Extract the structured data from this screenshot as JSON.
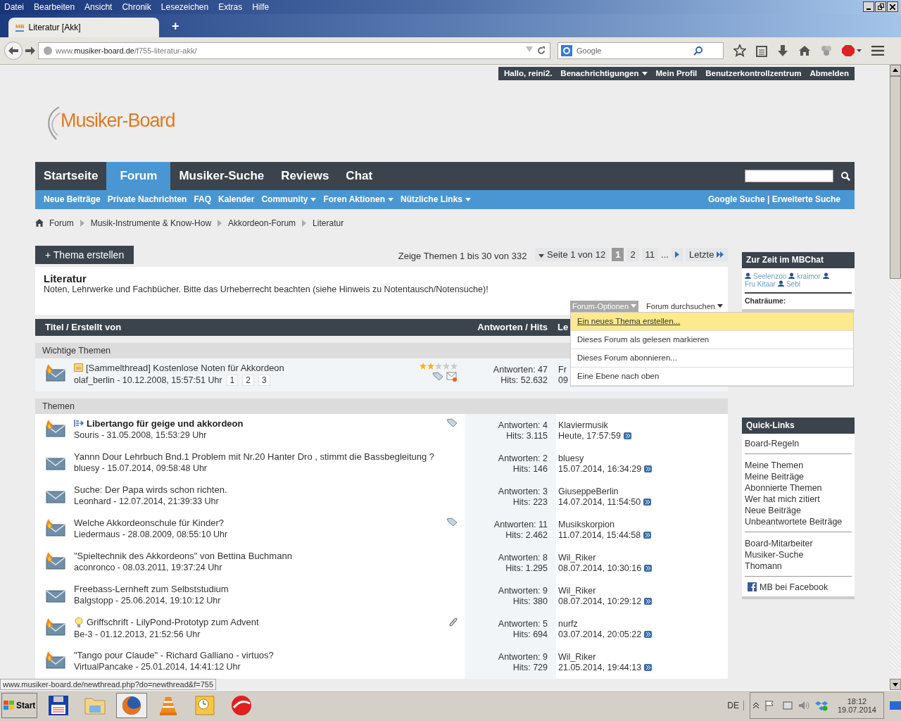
{
  "browser": {
    "menu": [
      "Datei",
      "Bearbeiten",
      "Ansicht",
      "Chronik",
      "Lesezeichen",
      "Extras",
      "Hilfe"
    ],
    "tab": {
      "favicon": "MB",
      "title": "Literatur [Akk]"
    },
    "new_tab": "+",
    "url": {
      "host_prefix": "www.",
      "host": "musiker-board.de",
      "path": "/f755-literatur-akk/"
    },
    "search": {
      "placeholder": "Google"
    },
    "status_link": "www.musiker-board.de/newthread.php?do=newthread&f=755"
  },
  "user_bar": [
    "Hallo, reini2.",
    "Benachrichtigungen",
    "Mein Profil",
    "Benutzerkontrollzentrum",
    "Abmelden"
  ],
  "logo": "Musiker-Board",
  "main_nav": [
    {
      "label": "Startseite",
      "selected": false
    },
    {
      "label": "Forum",
      "selected": true
    },
    {
      "label": "Musiker-Suche",
      "selected": false
    },
    {
      "label": "Reviews",
      "selected": false
    },
    {
      "label": "Chat",
      "selected": false
    }
  ],
  "sub_nav": [
    {
      "label": "Neue Beiträge",
      "dropdown": false
    },
    {
      "label": "Private Nachrichten",
      "dropdown": false
    },
    {
      "label": "FAQ",
      "dropdown": false
    },
    {
      "label": "Kalender",
      "dropdown": false
    },
    {
      "label": "Community",
      "dropdown": true
    },
    {
      "label": "Foren Aktionen",
      "dropdown": true
    },
    {
      "label": "Nützliche Links",
      "dropdown": true
    }
  ],
  "sub_nav_right": "Google Suche | Erweiterte Suche",
  "breadcrumb": [
    "Forum",
    "Musik-Instrumente & Know-How",
    "Akkordeon-Forum",
    "Literatur"
  ],
  "new_thread_button": "+ Thema erstellen",
  "range": "Zeige Themen 1 bis 30 von 332",
  "pagination": {
    "label": "Seite 1 von 12",
    "pages": [
      {
        "label": "1",
        "selected": true
      },
      {
        "label": "2",
        "selected": false
      },
      {
        "label": "11",
        "selected": false
      }
    ],
    "ellipsis": "...",
    "last": "Letzte"
  },
  "forum": {
    "title": "Literatur",
    "description_before": "Noten, Lehrwerke und Fachbücher. Bitte das Urheberrecht beachten (siehe Hinweis zu ",
    "link": "Notentausch/Notensuche",
    "description_after": ")!"
  },
  "options": {
    "label": "Forum-Optionen",
    "open": true,
    "items": [
      {
        "label": "Ein neues Thema erstellen...",
        "selected": true
      },
      {
        "label": "Dieses Forum als gelesen markieren",
        "selected": false
      },
      {
        "label": "Dieses Forum abonnieren...",
        "selected": false
      },
      {
        "label": "Eine Ebene nach oben",
        "selected": false
      }
    ]
  },
  "search_forum": "Forum durchsuchen",
  "table": {
    "columns": [
      "Titel / Erstellt von",
      "Antworten / Hits",
      "Le"
    ]
  },
  "sections": [
    {
      "title": "Wichtige Themen",
      "sticky": true,
      "threads": [
        {
          "hot": true,
          "prefix": {
            "kind": "note"
          },
          "unread": false,
          "title": "[Sammelthread] Kostenlose Noten für Akkordeon",
          "starter": "olaf_berlin - 10.12.2008, 15:57:51 Uhr",
          "pages": [
            "1",
            "2",
            "3"
          ],
          "stars": 2,
          "badges": [
            {
              "kind": "tag"
            },
            {
              "kind": "mail"
            }
          ],
          "replies": "Antworten: 47",
          "hits": "Hits: 52.632",
          "last_user": "Fr",
          "last_time": "09"
        }
      ]
    },
    {
      "title": "Themen",
      "sticky": false,
      "threads": [
        {
          "hot": true,
          "prefix": {
            "kind": "first-unread"
          },
          "unread": true,
          "title": "Libertango für geige und akkordeon",
          "starter": "Souris - 31.05.2008, 15:53:29 Uhr",
          "badges": [
            {
              "kind": "tag"
            }
          ],
          "replies": "Antworten: 4",
          "hits": "Hits: 3.115",
          "last_user": "Klaviermusik",
          "last_time": "Heute, 17:57:59"
        },
        {
          "hot": false,
          "unread": false,
          "title": "Yannn Dour Lehrbuch Bnd.1 Problem mit Nr.20 Hanter Dro , stimmt die Bassbegleitung ?",
          "starter": "bluesy - 15.07.2014, 09:58:48 Uhr",
          "replies": "Antworten: 2",
          "hits": "Hits: 146",
          "last_user": "bluesy",
          "last_time": "15.07.2014, 16:34:29"
        },
        {
          "hot": false,
          "unread": false,
          "title": "Suche: Der Papa wirds schon richten.",
          "starter": "Leonhard - 12.07.2014, 21:39:33 Uhr",
          "replies": "Antworten: 3",
          "hits": "Hits: 223",
          "last_user": "GiuseppeBerlin",
          "last_time": "14.07.2014, 11:54:50"
        },
        {
          "hot": true,
          "unread": false,
          "title": "Welche Akkordeonschule für Kinder?",
          "starter": "Liedermaus - 28.08.2009, 08:55:10 Uhr",
          "badges": [
            {
              "kind": "tag"
            }
          ],
          "replies": "Antworten: 11",
          "hits": "Hits: 2.462",
          "last_user": "Musikskorpion",
          "last_time": "11.07.2014, 15:44:58"
        },
        {
          "hot": true,
          "unread": false,
          "title": "\"Spieltechnik des Akkordeons\" von Bettina Buchmann",
          "starter": "aconronco - 08.03.2011, 19:37:24 Uhr",
          "replies": "Antworten: 8",
          "hits": "Hits: 1.295",
          "last_user": "Wil_Riker",
          "last_time": "08.07.2014, 10:30:16"
        },
        {
          "hot": false,
          "unread": false,
          "title": "Freebass-Lernheft zum Selbststudium",
          "starter": "Balgstopp - 25.06.2014, 19:10:12 Uhr",
          "replies": "Antworten: 9",
          "hits": "Hits: 380",
          "last_user": "Wil_Riker",
          "last_time": "08.07.2014, 10:29:12"
        },
        {
          "hot": true,
          "prefix": {
            "kind": "bulb"
          },
          "unread": false,
          "title": "Griffschrift - LilyPond-Prototyp zum Advent",
          "starter": "Be-3 - 01.12.2013, 21:52:56 Uhr",
          "badges": [
            {
              "kind": "attachment"
            }
          ],
          "replies": "Antworten: 5",
          "hits": "Hits: 694",
          "last_user": "nurfz",
          "last_time": "03.07.2014, 20:05:22"
        },
        {
          "hot": true,
          "unread": false,
          "title": "\"Tango pour Claude\" - Richard Galliano - virtuos?",
          "starter": "VirtualPancake - 25.01.2014, 14:41:12 Uhr",
          "replies": "Antworten: 9",
          "hits": "Hits: 729",
          "last_user": "Wil_Riker",
          "last_time": "21.05.2014, 19:44:13"
        }
      ]
    }
  ],
  "chat_box": {
    "title": "Zur Zeit im MBChat",
    "users": [
      "Seelenzoo",
      "kraimor",
      "Fru Kitaar",
      "Sebl"
    ],
    "rooms_label": "Chaträume:"
  },
  "quick_links": {
    "title": "Quick-Links",
    "groups": [
      [
        "Board-Regeln"
      ],
      [
        "Meine Themen",
        "Meine Beiträge",
        "Abonnierte Themen",
        "Wer hat mich zitiert",
        "Neue Beiträge",
        "Unbeantwortete Beiträge"
      ],
      [
        "Board-Mitarbeiter",
        "Musiker-Suche",
        "Thomann"
      ]
    ],
    "facebook": "MB bei Facebook"
  },
  "taskbar": {
    "start": "Start",
    "apps": [
      {
        "kind": "floppy",
        "selected": false
      },
      {
        "kind": "explorer",
        "selected": false
      },
      {
        "kind": "firefox",
        "selected": true
      },
      {
        "kind": "vlc",
        "selected": false
      },
      {
        "kind": "outlook",
        "selected": false
      },
      {
        "kind": "circle",
        "selected": false
      }
    ],
    "language": "DE",
    "time": "18:12",
    "date": "19.07.2014"
  }
}
